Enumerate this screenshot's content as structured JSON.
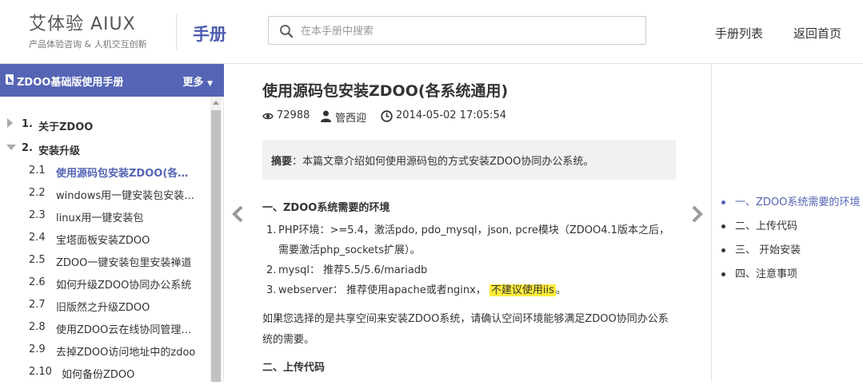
{
  "header": {
    "logo_main": "艾体验 AIUX",
    "logo_sub": "产品体验咨询 & 人机交互创新",
    "manual_title": "手册",
    "search_placeholder": "在本手册中搜索",
    "nav": [
      "手册列表",
      "返回首页"
    ]
  },
  "sidebar": {
    "title": "ZDOO基础版使用手册",
    "more_label": "更多",
    "sections": [
      {
        "num": "1.",
        "label": "关于ZDOO",
        "expanded": false
      },
      {
        "num": "2.",
        "label": "安装升级",
        "expanded": true
      }
    ],
    "items": [
      {
        "num": "2.1",
        "label": "使用源码包安装ZDOO(各系统通用)",
        "active": true
      },
      {
        "num": "2.2",
        "label": "windows用一键安装包安装(推荐)"
      },
      {
        "num": "2.3",
        "label": "linux用一键安装包"
      },
      {
        "num": "2.4",
        "label": "宝塔面板安装ZDOO"
      },
      {
        "num": "2.5",
        "label": "ZDOO一键安装包里安装禅道"
      },
      {
        "num": "2.6",
        "label": "如何升级ZDOO协同办公系统"
      },
      {
        "num": "2.7",
        "label": "旧版然之升级ZDOO"
      },
      {
        "num": "2.8",
        "label": "使用ZDOO云在线协同管理平台"
      },
      {
        "num": "2.9",
        "label": "去掉ZDOO访问地址中的zdoo"
      },
      {
        "num": "2.10",
        "label": "如何备份ZDOO"
      }
    ]
  },
  "article": {
    "title": "使用源码包安装ZDOO(各系统通用)",
    "views": "72988",
    "author": "管西迎",
    "datetime": "2014-05-02 17:05:54",
    "abstract_label": "摘要",
    "abstract_text": "：本篇文章介绍如何使用源码包的方式安装ZDOO协同办公系统。",
    "section1_heading": "一、ZDOO系统需要的环境",
    "list": [
      {
        "n": "1.",
        "text": "PHP环境：>=5.4，激活pdo, pdo_mysql，json, pcre模块（ZDOO4.1版本之后，需要激活php_sockets扩展）。"
      },
      {
        "n": "2.",
        "text": "mysql： 推荐5.5/5.6/mariadb"
      },
      {
        "n": "3.",
        "text": "webserver： 推荐使用apache或者nginx， ",
        "highlight": "不建议使用iis",
        "tail": "。"
      }
    ],
    "paragraph": "如果您选择的是共享空间来安装ZDOO系统，请确认空间环境能够满足ZDOO协同办公系统的需要。",
    "section2_heading": "二、上传代码"
  },
  "right_toc": {
    "items": [
      {
        "label": "一、ZDOO系统需要的环境",
        "active": true
      },
      {
        "label": "二、上传代码"
      },
      {
        "label": "三、 开始安装"
      },
      {
        "label": "四、注意事项"
      }
    ]
  },
  "colors": {
    "accent": "#5564b4",
    "highlight": "#ffeb3b"
  }
}
